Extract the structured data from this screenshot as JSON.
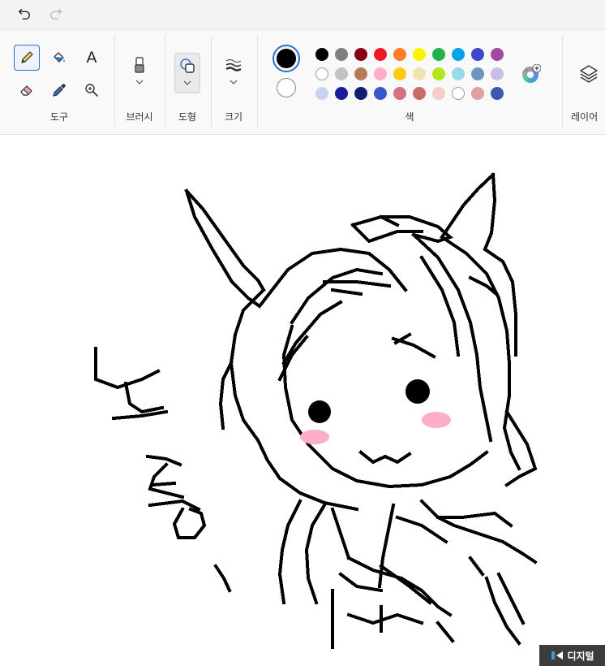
{
  "toolbar": {
    "undo_icon": "undo-icon",
    "redo_icon": "redo-icon"
  },
  "groups": {
    "tools": "도구",
    "brushes": "브러시",
    "shapes": "도형",
    "size": "크기",
    "colors": "색",
    "layers": "레이어"
  },
  "tools": [
    {
      "name": "pencil",
      "icon": "pencil-icon",
      "active": true
    },
    {
      "name": "fill",
      "icon": "paint-bucket-icon",
      "active": false
    },
    {
      "name": "text",
      "icon": "text-icon",
      "glyph": "A",
      "active": false
    },
    {
      "name": "eraser",
      "icon": "eraser-icon",
      "active": false
    },
    {
      "name": "color-picker",
      "icon": "eyedropper-icon",
      "active": false
    },
    {
      "name": "magnifier",
      "icon": "magnifier-icon",
      "active": false
    }
  ],
  "colors": {
    "primary": "#000000",
    "secondary": "#ffffff",
    "accent": "#2a6fc9",
    "palette_row1": [
      "#000000",
      "#7f7f7f",
      "#880015",
      "#ed1c24",
      "#ff7f27",
      "#fff200",
      "#22b14c",
      "#00a2e8",
      "#3f48cc",
      "#a349a4"
    ],
    "palette_row2": [
      "#ffffff",
      "#c3c3c3",
      "#b97a57",
      "#ffaec9",
      "#ffc90e",
      "#efe4b0",
      "#b5e61d",
      "#99d9ea",
      "#7092be",
      "#c8bfe7"
    ],
    "palette_row3": [
      "#c8d3f0",
      "#1a1a9e",
      "#0f1f6e",
      "#3a56c8",
      "#d4727e",
      "#c76b6b",
      "#f5cccc",
      "#ffffff",
      "#e39e9e",
      "#4056b0"
    ]
  },
  "watermark": {
    "text": "디지털"
  }
}
